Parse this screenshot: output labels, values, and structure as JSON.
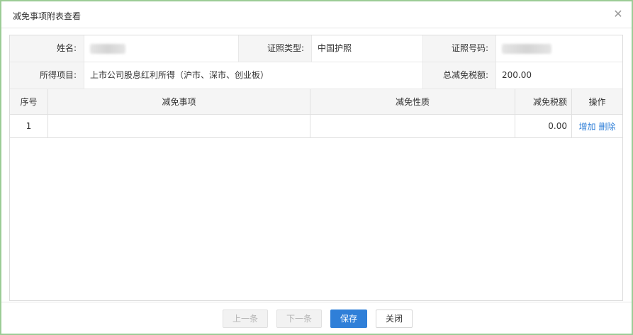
{
  "dialog": {
    "title": "减免事项附表查看",
    "close_glyph": "✕"
  },
  "info": {
    "name_label": "姓名:",
    "id_type_label": "证照类型:",
    "id_type_value": "中国护照",
    "id_number_label": "证照号码:",
    "income_item_label": "所得项目:",
    "income_item_value": "上市公司股息红利所得（沪市、深市、创业板）",
    "total_reduction_label": "总减免税额:",
    "total_reduction_value": "200.00"
  },
  "table": {
    "columns": [
      "序号",
      "减免事项",
      "减免性质",
      "减免税额",
      "操作"
    ],
    "rows": [
      {
        "index": "1",
        "item": "",
        "nature": "",
        "amount": "0.00",
        "add_label": "增加",
        "delete_label": "删除"
      }
    ]
  },
  "footer": {
    "prev_label": "上一条",
    "next_label": "下一条",
    "save_label": "保存",
    "close_label": "关闭"
  },
  "colors": {
    "accent": "#2f7fd8",
    "dialog_border": "#9ccc96"
  }
}
